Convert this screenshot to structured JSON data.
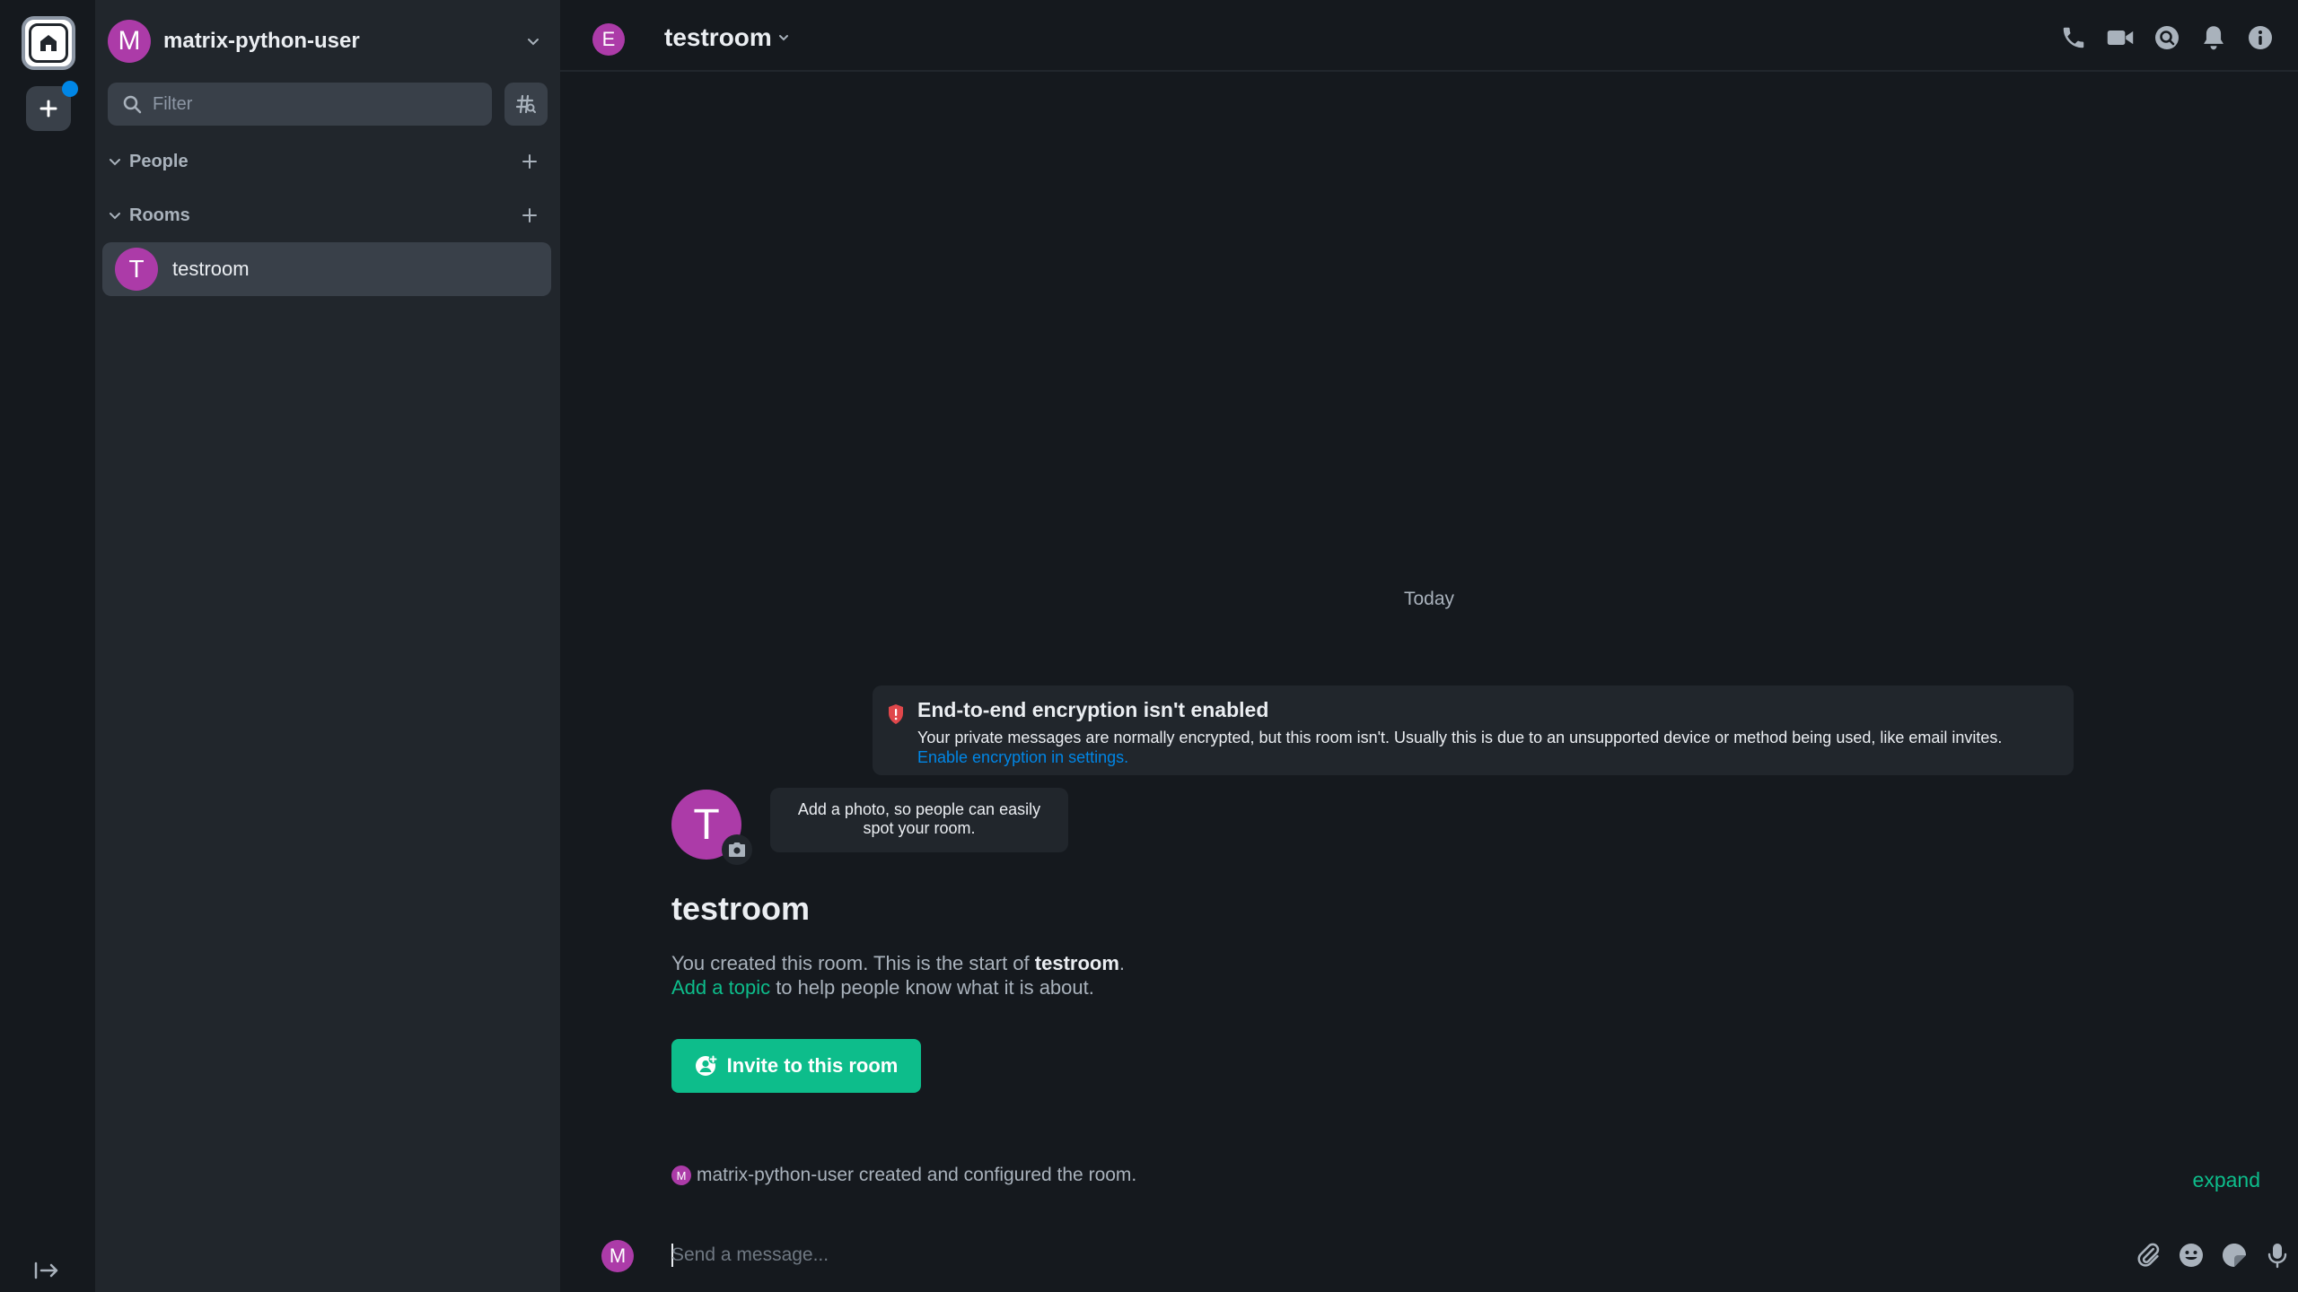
{
  "account": {
    "avatar_letter": "M",
    "username": "matrix-python-user"
  },
  "filter": {
    "placeholder": "Filter"
  },
  "sections": {
    "people": "People",
    "rooms": "Rooms"
  },
  "room_list": [
    {
      "avatar_letter": "T",
      "name": "testroom"
    }
  ],
  "room_header": {
    "avatar_letter": "E",
    "title": "testroom"
  },
  "timeline": {
    "date_separator": "Today",
    "e2e_notice": {
      "title": "End-to-end encryption isn't enabled",
      "description": "Your private messages are normally encrypted, but this room isn't. Usually this is due to an unsupported device or method being used, like email invites.",
      "link": "Enable encryption in settings."
    },
    "room_avatar_letter": "T",
    "photo_tip": "Add a photo, so people can easily spot your room.",
    "room_name": "testroom",
    "intro_prefix": "You created this room. This is the start of ",
    "intro_room": "testroom",
    "intro_suffix": ".",
    "topic_link": "Add a topic",
    "topic_suffix": " to help people know what it is about.",
    "invite_label": "Invite to this room",
    "summary_avatar_letter": "M",
    "created_summary": "matrix-python-user created and configured the room.",
    "expand_label": "expand"
  },
  "composer": {
    "avatar_letter": "M",
    "placeholder": "Send a message..."
  },
  "colors": {
    "accent": "#0dbd8b",
    "avatar": "#ac3ba8",
    "link": "#0086e6",
    "warning": "#e0474b"
  },
  "icons": {
    "spacebar": [
      "home-icon",
      "plus-icon",
      "expand-spaces-icon"
    ],
    "header": [
      "phone-icon",
      "video-icon",
      "search-icon",
      "bell-icon",
      "info-icon"
    ],
    "composer": [
      "paperclip-icon",
      "emoji-icon",
      "sticker-icon",
      "microphone-icon"
    ]
  }
}
